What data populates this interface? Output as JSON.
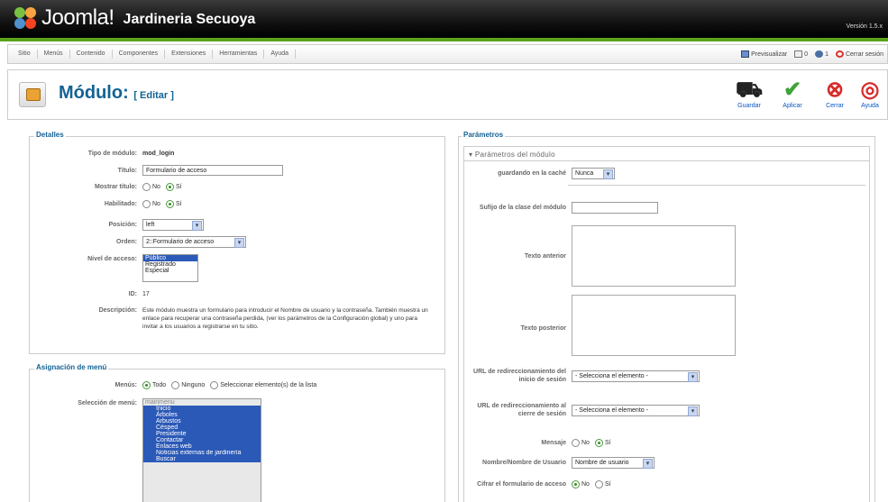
{
  "header": {
    "logo_text": "Joomla!",
    "site_name": "Jardineria Secuoya",
    "version": "Versión 1.5.x"
  },
  "menu": {
    "items": [
      "Sitio",
      "Menús",
      "Contenido",
      "Componentes",
      "Extensiones",
      "Herramientas",
      "Ayuda"
    ],
    "preview": "Previsualizar",
    "messages": "0",
    "users": "1",
    "logout": "Cerrar sesión"
  },
  "toolbar": {
    "title": "Módulo:",
    "subtitle": "[ Editar ]",
    "save": "Guardar",
    "apply": "Aplicar",
    "close": "Cerrar",
    "help": "Ayuda"
  },
  "details": {
    "legend": "Detalles",
    "module_type_label": "Tipo de módulo:",
    "module_type": "mod_login",
    "title_label": "Título:",
    "title_value": "Formulario de acceso",
    "show_title_label": "Mostrar título:",
    "enabled_label": "Habilitado:",
    "no": "No",
    "yes": "Sí",
    "position_label": "Posición:",
    "position_value": "left",
    "order_label": "Orden:",
    "order_value": "2::Formulario de acceso",
    "access_label": "Nivel de acceso:",
    "access_options": [
      "Público",
      "Registrado",
      "Especial"
    ],
    "id_label": "ID:",
    "id_value": "17",
    "description_label": "Descripción:",
    "description": "Este módulo muestra un formulario para introducir el Nombre de usuario y la contraseña. También muestra un enlace para recuperar una contraseña perdida, (ver los parámetros de la Configuración global) y uno para invitar a los usuarios a registrarse en tu sitio."
  },
  "menu_assign": {
    "legend": "Asignación de menú",
    "menus_label": "Menús:",
    "all": "Todo",
    "none": "Ninguno",
    "select": "Seleccionar elemento(s) de la lista",
    "selection_label": "Selección de menú:",
    "items": [
      "mainmenu",
      "Inicio",
      "Árboles",
      "Arbustos",
      "Césped",
      "Presidente",
      "Contactar",
      "Enlaces web",
      "Noticias externas de jardinería",
      "Buscar"
    ]
  },
  "params": {
    "legend": "Parámetros",
    "sub": "Parámetros del módulo",
    "cache_label": "guardando en la caché",
    "cache_value": "Nunca",
    "suffix_label": "Sufijo de la clase del módulo",
    "pretext_label": "Texto anterior",
    "posttext_label": "Texto posterior",
    "login_redirect_label": "URL de redireccionamiento del inicio de sesión",
    "logout_redirect_label": "URL de redireccionamiento al cierre de sesión",
    "select_item": "- Selecciona el elemento -",
    "greeting_label": "Mensaje",
    "name_label": "Nombre/Nombre de Usuario",
    "name_value": "Nombre de usuario",
    "encrypt_label": "Cifrar el formulario de acceso"
  }
}
